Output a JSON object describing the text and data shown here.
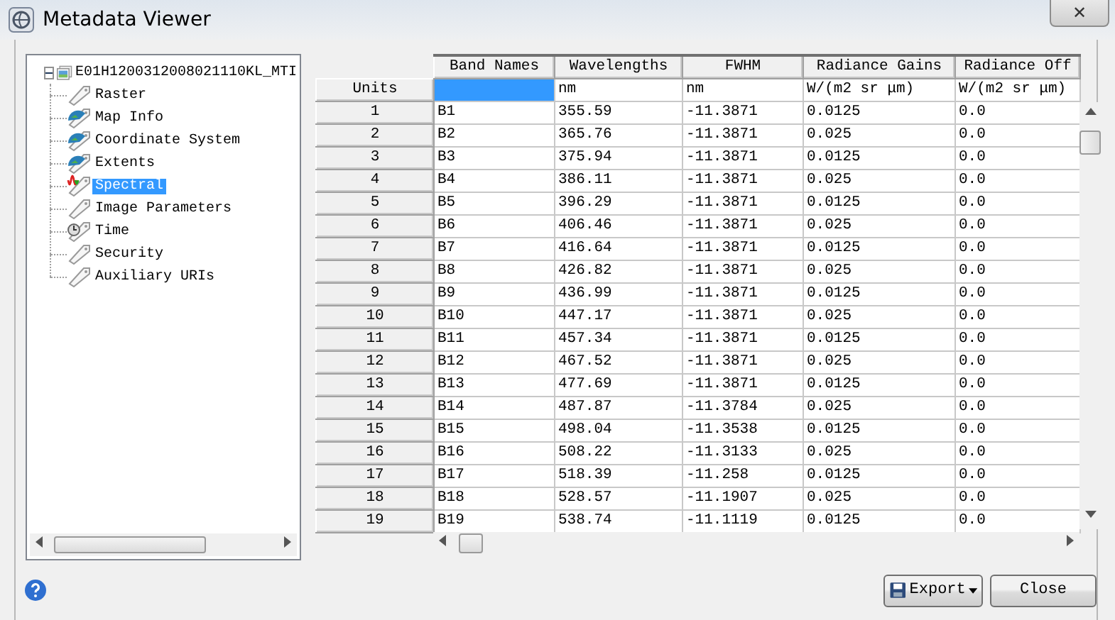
{
  "window": {
    "title": "Metadata Viewer",
    "close": "✕"
  },
  "tree": {
    "root": {
      "label": "E01H1200312008021110KL_MTI",
      "expanded": true,
      "children": [
        {
          "label": "Raster",
          "kind": "tag",
          "selected": false
        },
        {
          "label": "Map Info",
          "kind": "geo",
          "selected": false
        },
        {
          "label": "Coordinate System",
          "kind": "geo",
          "selected": false
        },
        {
          "label": "Extents",
          "kind": "geo",
          "selected": false
        },
        {
          "label": "Spectral",
          "kind": "spectral",
          "selected": true
        },
        {
          "label": "Image Parameters",
          "kind": "tag",
          "selected": false
        },
        {
          "label": "Time",
          "kind": "time",
          "selected": false
        },
        {
          "label": "Security",
          "kind": "tag",
          "selected": false
        },
        {
          "label": "Auxiliary URIs",
          "kind": "tag",
          "selected": false
        }
      ]
    }
  },
  "table": {
    "columns": [
      "Band Names",
      "Wavelengths",
      "FWHM",
      "Radiance Gains",
      "Radiance Off"
    ],
    "units_label": "Units",
    "units": [
      {
        "selected": true
      },
      {
        "text": "nm",
        "selected": false
      },
      {
        "text": "nm",
        "selected": false
      },
      {
        "text": "W/(m2 sr μm)",
        "selected": false
      },
      {
        "text": "W/(m2 sr μm)",
        "selected": false
      }
    ],
    "rows": [
      {
        "header": "1",
        "cells": [
          "B1",
          "355.59",
          "-11.3871",
          "0.0125",
          "0.0"
        ]
      },
      {
        "header": "2",
        "cells": [
          "B2",
          "365.76",
          "-11.3871",
          "0.025",
          "0.0"
        ]
      },
      {
        "header": "3",
        "cells": [
          "B3",
          "375.94",
          "-11.3871",
          "0.0125",
          "0.0"
        ]
      },
      {
        "header": "4",
        "cells": [
          "B4",
          "386.11",
          "-11.3871",
          "0.025",
          "0.0"
        ]
      },
      {
        "header": "5",
        "cells": [
          "B5",
          "396.29",
          "-11.3871",
          "0.0125",
          "0.0"
        ]
      },
      {
        "header": "6",
        "cells": [
          "B6",
          "406.46",
          "-11.3871",
          "0.025",
          "0.0"
        ]
      },
      {
        "header": "7",
        "cells": [
          "B7",
          "416.64",
          "-11.3871",
          "0.0125",
          "0.0"
        ]
      },
      {
        "header": "8",
        "cells": [
          "B8",
          "426.82",
          "-11.3871",
          "0.025",
          "0.0"
        ]
      },
      {
        "header": "9",
        "cells": [
          "B9",
          "436.99",
          "-11.3871",
          "0.0125",
          "0.0"
        ]
      },
      {
        "header": "10",
        "cells": [
          "B10",
          "447.17",
          "-11.3871",
          "0.025",
          "0.0"
        ]
      },
      {
        "header": "11",
        "cells": [
          "B11",
          "457.34",
          "-11.3871",
          "0.0125",
          "0.0"
        ]
      },
      {
        "header": "12",
        "cells": [
          "B12",
          "467.52",
          "-11.3871",
          "0.025",
          "0.0"
        ]
      },
      {
        "header": "13",
        "cells": [
          "B13",
          "477.69",
          "-11.3871",
          "0.0125",
          "0.0"
        ]
      },
      {
        "header": "14",
        "cells": [
          "B14",
          "487.87",
          "-11.3784",
          "0.025",
          "0.0"
        ]
      },
      {
        "header": "15",
        "cells": [
          "B15",
          "498.04",
          "-11.3538",
          "0.0125",
          "0.0"
        ]
      },
      {
        "header": "16",
        "cells": [
          "B16",
          "508.22",
          "-11.3133",
          "0.025",
          "0.0"
        ]
      },
      {
        "header": "17",
        "cells": [
          "B17",
          "518.39",
          "-11.258",
          "0.0125",
          "0.0"
        ]
      },
      {
        "header": "18",
        "cells": [
          "B18",
          "528.57",
          "-11.1907",
          "0.025",
          "0.0"
        ]
      },
      {
        "header": "19",
        "cells": [
          "B19",
          "538.74",
          "-11.1119",
          "0.0125",
          "0.0"
        ]
      }
    ]
  },
  "buttons": [
    {
      "label": "Export",
      "kind": "menu"
    },
    {
      "label": "Close",
      "kind": "plain"
    }
  ]
}
